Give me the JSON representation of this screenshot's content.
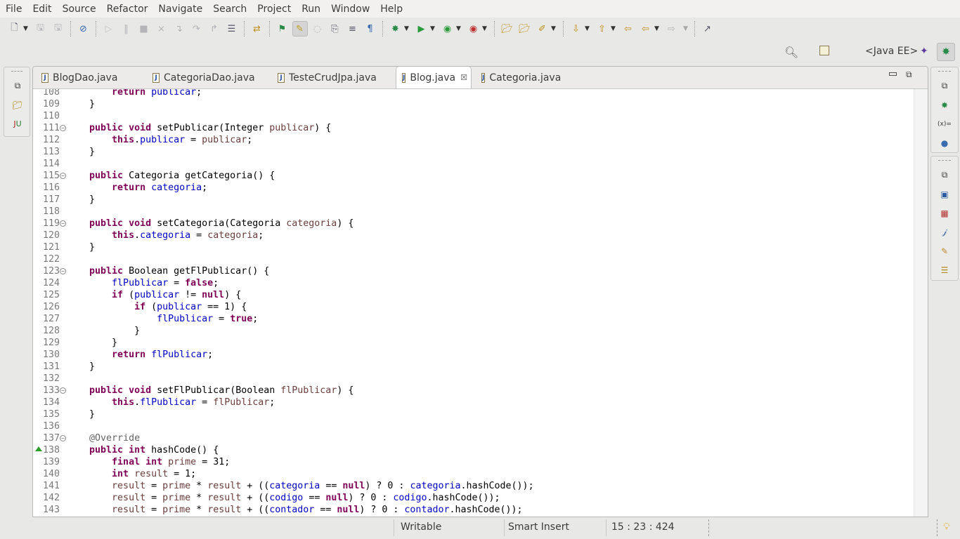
{
  "menu": [
    "File",
    "Edit",
    "Source",
    "Refactor",
    "Navigate",
    "Search",
    "Project",
    "Run",
    "Window",
    "Help"
  ],
  "toolbar": {
    "icons": [
      "new-icon",
      "save-icon",
      "save-all-icon",
      "skip-breakpoints-icon",
      "resume-icon",
      "suspend-icon",
      "terminate-icon",
      "disconnect-icon",
      "step-into-icon",
      "step-over-icon",
      "step-return-icon",
      "drop-to-frame-icon",
      "use-step-filters-icon",
      "new-server-icon",
      "mark-occurrences-icon",
      "block-selection-icon",
      "toggle-breadcrumb-icon",
      "word-wrap-icon",
      "show-whitespace-icon",
      "debug-icon",
      "run-icon",
      "coverage-icon",
      "external-tools-icon",
      "open-type-icon",
      "open-task-icon",
      "search-icon",
      "next-annotation-icon",
      "previous-annotation-icon",
      "last-edit-icon",
      "back-icon",
      "forward-icon",
      "open-perspective-icon"
    ]
  },
  "perspective": {
    "label": "<Java EE>"
  },
  "tabs": [
    {
      "label": "BlogDao.java"
    },
    {
      "label": "CategoriaDao.java"
    },
    {
      "label": "TesteCrudJpa.java"
    },
    {
      "label": "Blog.java",
      "active": true
    },
    {
      "label": "Categoria.java"
    }
  ],
  "code": {
    "first_line": 108,
    "folds": [
      111,
      115,
      119,
      123,
      133,
      137
    ],
    "override_marker": 138,
    "lines": [
      [
        [
          "t",
          "        "
        ],
        [
          "k",
          "return"
        ],
        [
          "t",
          " "
        ],
        [
          "f",
          "publicar"
        ],
        [
          "t",
          ";"
        ]
      ],
      [
        [
          "t",
          "    }"
        ]
      ],
      [],
      [
        [
          "t",
          "    "
        ],
        [
          "k",
          "public"
        ],
        [
          "t",
          " "
        ],
        [
          "k",
          "void"
        ],
        [
          "t",
          " setPublicar(Integer "
        ],
        [
          "p",
          "publicar"
        ],
        [
          "t",
          ") {"
        ]
      ],
      [
        [
          "t",
          "        "
        ],
        [
          "k",
          "this"
        ],
        [
          "t",
          "."
        ],
        [
          "f",
          "publicar"
        ],
        [
          "t",
          " = "
        ],
        [
          "p",
          "publicar"
        ],
        [
          "t",
          ";"
        ]
      ],
      [
        [
          "t",
          "    }"
        ]
      ],
      [],
      [
        [
          "t",
          "    "
        ],
        [
          "k",
          "public"
        ],
        [
          "t",
          " Categoria getCategoria() {"
        ]
      ],
      [
        [
          "t",
          "        "
        ],
        [
          "k",
          "return"
        ],
        [
          "t",
          " "
        ],
        [
          "f",
          "categoria"
        ],
        [
          "t",
          ";"
        ]
      ],
      [
        [
          "t",
          "    }"
        ]
      ],
      [],
      [
        [
          "t",
          "    "
        ],
        [
          "k",
          "public"
        ],
        [
          "t",
          " "
        ],
        [
          "k",
          "void"
        ],
        [
          "t",
          " setCategoria(Categoria "
        ],
        [
          "p",
          "categoria"
        ],
        [
          "t",
          ") {"
        ]
      ],
      [
        [
          "t",
          "        "
        ],
        [
          "k",
          "this"
        ],
        [
          "t",
          "."
        ],
        [
          "f",
          "categoria"
        ],
        [
          "t",
          " = "
        ],
        [
          "p",
          "categoria"
        ],
        [
          "t",
          ";"
        ]
      ],
      [
        [
          "t",
          "    }"
        ]
      ],
      [],
      [
        [
          "t",
          "    "
        ],
        [
          "k",
          "public"
        ],
        [
          "t",
          " Boolean getFlPublicar() {"
        ]
      ],
      [
        [
          "t",
          "        "
        ],
        [
          "f",
          "flPublicar"
        ],
        [
          "t",
          " = "
        ],
        [
          "k",
          "false"
        ],
        [
          "t",
          ";"
        ]
      ],
      [
        [
          "t",
          "        "
        ],
        [
          "k",
          "if"
        ],
        [
          "t",
          " ("
        ],
        [
          "f",
          "publicar"
        ],
        [
          "t",
          " != "
        ],
        [
          "k",
          "null"
        ],
        [
          "t",
          ") {"
        ]
      ],
      [
        [
          "t",
          "            "
        ],
        [
          "k",
          "if"
        ],
        [
          "t",
          " ("
        ],
        [
          "f",
          "publicar"
        ],
        [
          "t",
          " == 1) {"
        ]
      ],
      [
        [
          "t",
          "                "
        ],
        [
          "f",
          "flPublicar"
        ],
        [
          "t",
          " = "
        ],
        [
          "k",
          "true"
        ],
        [
          "t",
          ";"
        ]
      ],
      [
        [
          "t",
          "            }"
        ]
      ],
      [
        [
          "t",
          "        }"
        ]
      ],
      [
        [
          "t",
          "        "
        ],
        [
          "k",
          "return"
        ],
        [
          "t",
          " "
        ],
        [
          "f",
          "flPublicar"
        ],
        [
          "t",
          ";"
        ]
      ],
      [
        [
          "t",
          "    }"
        ]
      ],
      [],
      [
        [
          "t",
          "    "
        ],
        [
          "k",
          "public"
        ],
        [
          "t",
          " "
        ],
        [
          "k",
          "void"
        ],
        [
          "t",
          " setFlPublicar(Boolean "
        ],
        [
          "p",
          "flPublicar"
        ],
        [
          "t",
          ") {"
        ]
      ],
      [
        [
          "t",
          "        "
        ],
        [
          "k",
          "this"
        ],
        [
          "t",
          "."
        ],
        [
          "f",
          "flPublicar"
        ],
        [
          "t",
          " = "
        ],
        [
          "p",
          "flPublicar"
        ],
        [
          "t",
          ";"
        ]
      ],
      [
        [
          "t",
          "    }"
        ]
      ],
      [],
      [
        [
          "t",
          "    "
        ],
        [
          "a",
          "@Override"
        ]
      ],
      [
        [
          "t",
          "    "
        ],
        [
          "k",
          "public"
        ],
        [
          "t",
          " "
        ],
        [
          "k",
          "int"
        ],
        [
          "t",
          " hashCode() {"
        ]
      ],
      [
        [
          "t",
          "        "
        ],
        [
          "k",
          "final"
        ],
        [
          "t",
          " "
        ],
        [
          "k",
          "int"
        ],
        [
          "t",
          " "
        ],
        [
          "p",
          "prime"
        ],
        [
          "t",
          " = 31;"
        ]
      ],
      [
        [
          "t",
          "        "
        ],
        [
          "k",
          "int"
        ],
        [
          "t",
          " "
        ],
        [
          "p",
          "result"
        ],
        [
          "t",
          " = 1;"
        ]
      ],
      [
        [
          "t",
          "        "
        ],
        [
          "p",
          "result"
        ],
        [
          "t",
          " = "
        ],
        [
          "p",
          "prime"
        ],
        [
          "t",
          " * "
        ],
        [
          "p",
          "result"
        ],
        [
          "t",
          " + (("
        ],
        [
          "f",
          "categoria"
        ],
        [
          "t",
          " == "
        ],
        [
          "k",
          "null"
        ],
        [
          "t",
          ") ? 0 : "
        ],
        [
          "f",
          "categoria"
        ],
        [
          "t",
          ".hashCode());"
        ]
      ],
      [
        [
          "t",
          "        "
        ],
        [
          "p",
          "result"
        ],
        [
          "t",
          " = "
        ],
        [
          "p",
          "prime"
        ],
        [
          "t",
          " * "
        ],
        [
          "p",
          "result"
        ],
        [
          "t",
          " + (("
        ],
        [
          "f",
          "codigo"
        ],
        [
          "t",
          " == "
        ],
        [
          "k",
          "null"
        ],
        [
          "t",
          ") ? 0 : "
        ],
        [
          "f",
          "codigo"
        ],
        [
          "t",
          ".hashCode());"
        ]
      ],
      [
        [
          "t",
          "        "
        ],
        [
          "p",
          "result"
        ],
        [
          "t",
          " = "
        ],
        [
          "p",
          "prime"
        ],
        [
          "t",
          " * "
        ],
        [
          "p",
          "result"
        ],
        [
          "t",
          " + (("
        ],
        [
          "f",
          "contador"
        ],
        [
          "t",
          " == "
        ],
        [
          "k",
          "null"
        ],
        [
          "t",
          ") ? 0 : "
        ],
        [
          "f",
          "contador"
        ],
        [
          "t",
          ".hashCode());"
        ]
      ]
    ]
  },
  "status": {
    "writable": "Writable",
    "insert_mode": "Smart Insert",
    "position": "15 : 23 : 424"
  },
  "colors": {
    "keyword": "#7f0055",
    "field": "#0000c0",
    "parameter": "#6a3e3e",
    "annotation": "#646464"
  }
}
